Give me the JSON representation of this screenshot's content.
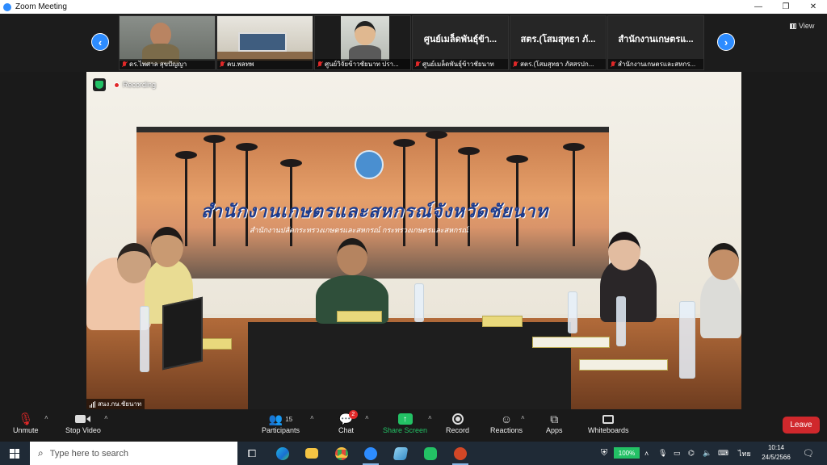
{
  "window": {
    "title": "Zoom Meeting",
    "minimize": "—",
    "maximize": "❐",
    "close": "✕"
  },
  "gallery": {
    "view_label": "View",
    "tiles": [
      {
        "name": "ดร.ไพศาล สุขปัญญา",
        "big_label": ""
      },
      {
        "name": "คบ.พลทพ",
        "big_label": ""
      },
      {
        "name": "ศูนย์วิจัยข้าวชัยนาท ปรา...",
        "big_label": ""
      },
      {
        "name": "ศูนย์เมล็ดพันธุ์ข้าวชัยนาท",
        "big_label": "ศูนย์เมล็ดพันธุ์ข้า..."
      },
      {
        "name": "สตร.(โสมสุทธา ภัสสรปก...",
        "big_label": "สตร.(โสมสุทธา ภั..."
      },
      {
        "name": "สำนักงานเกษตรและสหกร...",
        "big_label": "สำนักงานเกษตรแ..."
      }
    ]
  },
  "video": {
    "recording_label": "Recording",
    "speaker_name": "สนง.กษ.ชัยนาท",
    "banner_title": "สำนักงานเกษตรและสหกรณ์จังหวัดชัยนาท",
    "banner_subtitle": "สำนักงานปลัดกระทรวงเกษตรและสหกรณ์ กระทรวงเกษตรและสหกรณ์"
  },
  "toolbar": {
    "unmute": "Unmute",
    "stop_video": "Stop Video",
    "participants": "Participants",
    "participants_count": "15",
    "chat": "Chat",
    "chat_badge": "2",
    "share_screen": "Share Screen",
    "record": "Record",
    "reactions": "Reactions",
    "apps": "Apps",
    "whiteboards": "Whiteboards",
    "leave": "Leave"
  },
  "taskbar": {
    "search_placeholder": "Type here to search",
    "battery": "100%",
    "language": "ไทย",
    "time": "10:14",
    "date": "24/5/2566"
  },
  "colors": {
    "accent": "#2d8cff",
    "share": "#23c165",
    "leave": "#d0282c",
    "mute": "#e02828"
  }
}
